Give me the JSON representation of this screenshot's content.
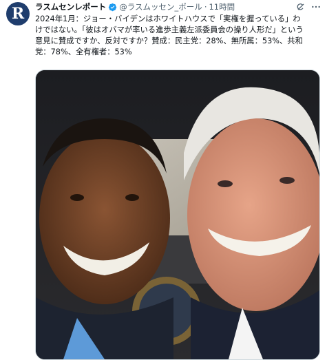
{
  "tweet": {
    "avatar_letter": "R",
    "author_name": "ラスムセンレポート",
    "handle": "@ラスムッセン_ポール",
    "separator": "·",
    "time": "11時間",
    "verified": true,
    "text_lines": [
      "2024年1月：ジョー・バイデンはホワイトハウスで「実権を握っている」わ",
      "けではない。「彼はオバマが率いる進歩主義左派委員会の操り人形だ」という",
      "意見に賛成ですか、反対ですか？賛成：民主党：28%、無所属：53%、共和",
      "党：78%、全有権者：53%"
    ],
    "media": {
      "description_icon": "photo-selfie"
    }
  },
  "colors": {
    "avatar_bg": "#1f3d6d",
    "verified_blue": "#1d9bf0",
    "muted_text": "#536471"
  }
}
